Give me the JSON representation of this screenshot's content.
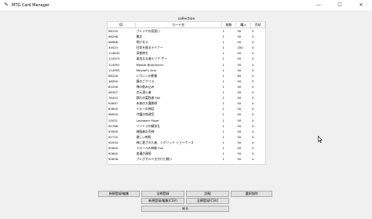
{
  "window": {
    "title": "MTG Card Manager",
    "minimize": "—",
    "maximize": "☐",
    "close": "✕"
  },
  "table": {
    "caption": "collection",
    "columns": [
      "ID",
      "カード名",
      "枚数",
      "購入",
      "売却"
    ],
    "rows": [
      [
        "98133",
        "プレイヤの見習い",
        "1",
        "50",
        "0"
      ],
      [
        "98298",
        "敗北",
        "1",
        "50",
        "0"
      ],
      [
        "98988",
        "明け仕え",
        "1",
        "50",
        "0"
      ],
      [
        "34523",
        "狂気を操るテイナー",
        "1",
        "200",
        "0"
      ],
      [
        "114842",
        "深夜終れ",
        "1",
        "50",
        "0"
      ],
      [
        "114973",
        "弟由なる者ルリア.ザー",
        "1",
        "50",
        "0"
      ],
      [
        "114952",
        "Master Biomancer",
        "1",
        "50",
        "0"
      ],
      [
        "114955",
        "Mayael's Aria",
        "1",
        "50",
        "0"
      ],
      [
        "68226",
        "レガニンの影像",
        "1",
        "80",
        "0"
      ],
      [
        "18050",
        "霧のごクリス",
        "1",
        "50",
        "0"
      ],
      [
        "62256",
        "弾の飲み込み",
        "1",
        "50",
        "0"
      ],
      [
        "46397",
        "次元潜入者",
        "1",
        "50",
        "0"
      ],
      [
        "76410",
        "群れの富牧者 Foil",
        "1",
        "50",
        "0"
      ],
      [
        "94697",
        "未来の大魔術師",
        "1",
        "50",
        "0"
      ],
      [
        "83600",
        "イルーの神話",
        "1",
        "50",
        "0"
      ],
      [
        "96900",
        "守護の執政官",
        "1",
        "50",
        "0"
      ],
      [
        "15031",
        "Lavaborn Muse",
        "1",
        "50",
        "0"
      ],
      [
        "92788",
        "ソリトラの精気孔",
        "1",
        "50",
        "0"
      ],
      [
        "93009",
        "肉脳者の売神",
        "1",
        "50",
        "0"
      ],
      [
        "92715",
        "激しい咆吼",
        "1",
        "50",
        "0"
      ],
      [
        "92934",
        "神に愛された者、シグリッド ショーケース",
        "1",
        "50",
        "0"
      ],
      [
        "92849",
        "トロールの神秘 Foil",
        "1",
        "50",
        "0"
      ],
      [
        "92840",
        "血溝の連続",
        "1",
        "50",
        "0"
      ],
      [
        "92836",
        "ブレグガルドきかけた戦い",
        "1",
        "50",
        "0"
      ]
    ]
  },
  "buttons": {
    "register_edit": "新規登録/編集",
    "bulk_register": "全網登録",
    "details": "詳細",
    "delete_selected": "選択削除",
    "register_edit_csv": "新規登録/編集(CSV)",
    "bulk_register_csv": "全網登録(CSV)",
    "back": "戻る"
  }
}
